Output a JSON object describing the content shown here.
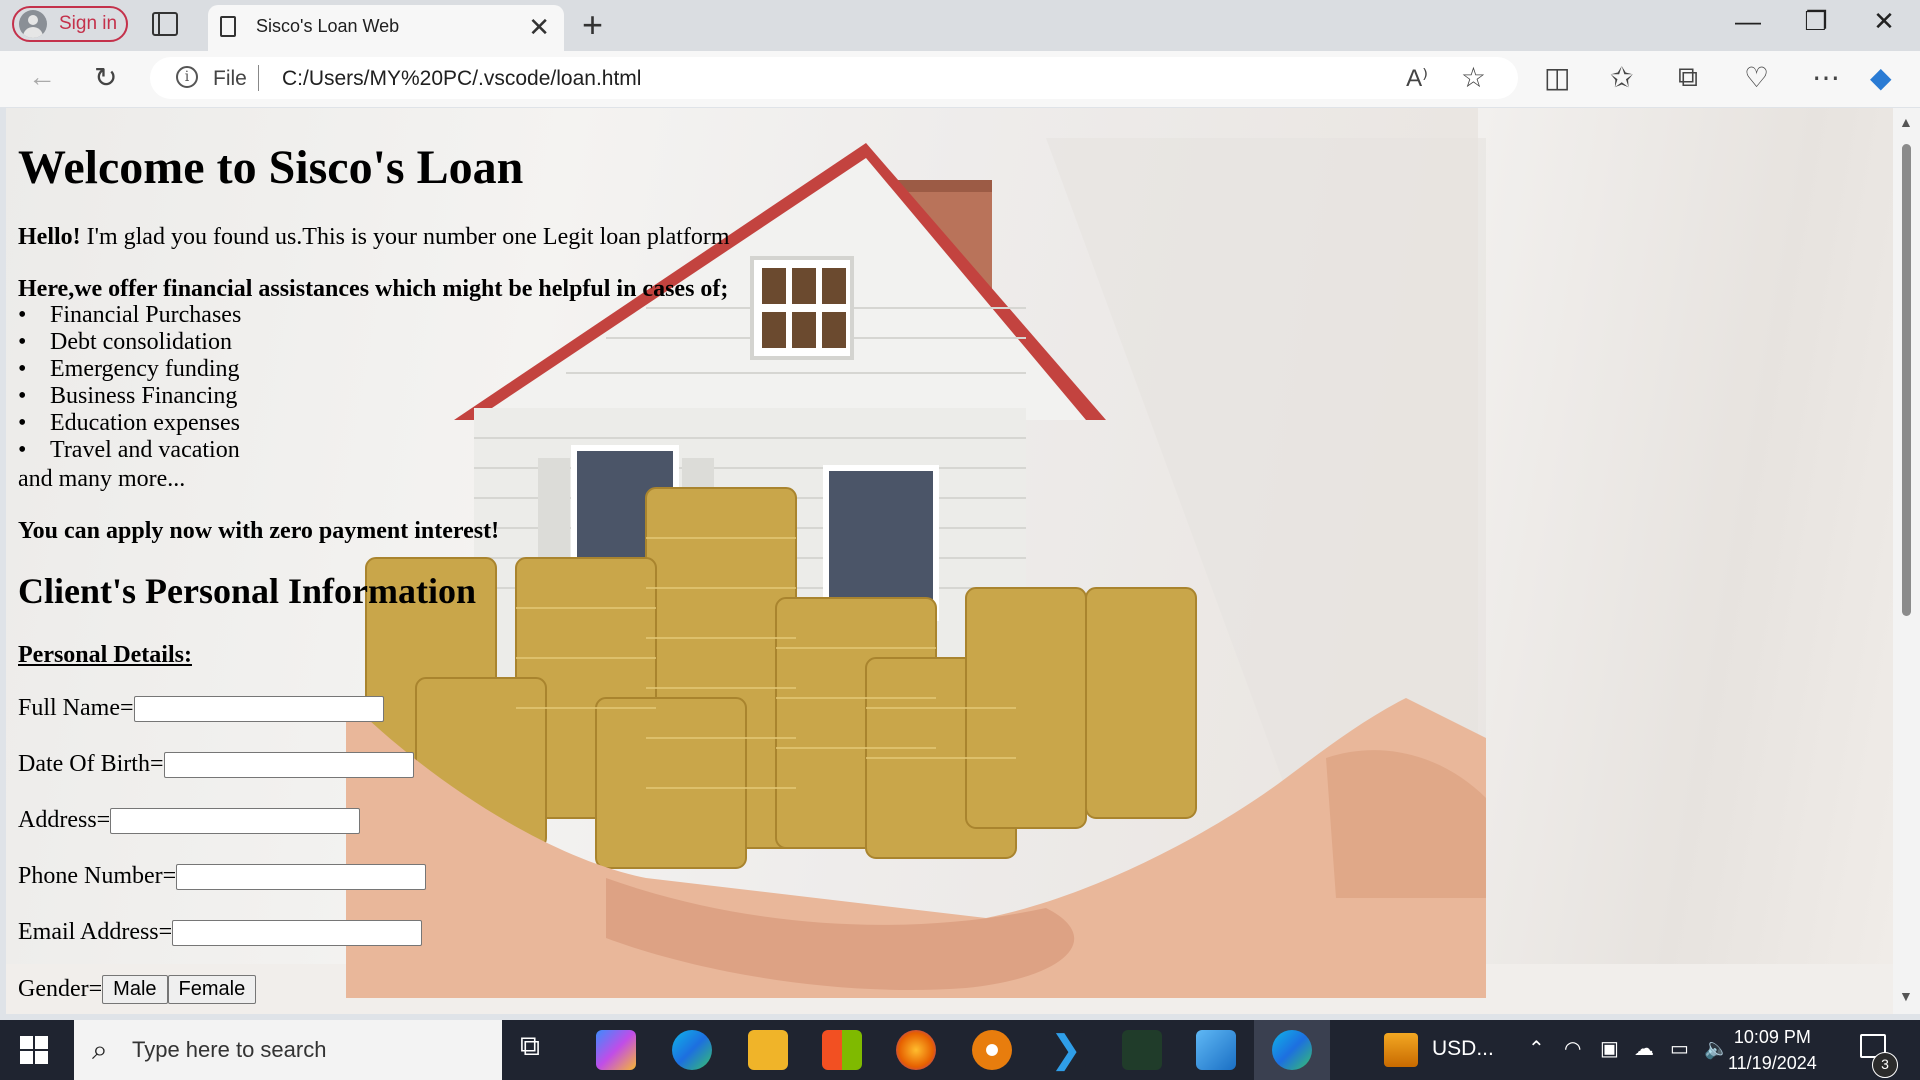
{
  "browser": {
    "signin_label": "Sign in",
    "tab_title": "Sisco's Loan Web",
    "url_scheme": "File",
    "url": "C:/Users/MY%20PC/.vscode/loan.html"
  },
  "page": {
    "heading": "Welcome to Sisco's Loan",
    "hello_bold": "Hello!",
    "hello_text": " I'm glad you found us.This is your number one Legit loan platform",
    "offer": "Here,we offer financial assistances which might be helpful in cases of;",
    "services": [
      "Financial Purchases",
      "Debt consolidation",
      "Emergency funding",
      "Business Financing",
      "Education expenses",
      "Travel and vacation"
    ],
    "more": "and many more...",
    "apply": "You can apply now with zero payment interest!",
    "section_title": "Client's Personal Information",
    "details_label": "Personal Details:",
    "fields": {
      "full_name": "Full Name=",
      "dob": "Date Of Birth=",
      "address": "Address=",
      "phone": "Phone Number=",
      "email": "Email Address=",
      "gender": "Gender="
    },
    "gender_options": [
      "Male",
      "Female"
    ]
  },
  "taskbar": {
    "search_placeholder": "Type here to search",
    "currency_widget": "USD...",
    "time": "10:09 PM",
    "date": "11/19/2024",
    "notification_count": "3"
  },
  "colors": {
    "signin_accent": "#c4314b",
    "taskbar_bg": "#1f2430",
    "tabstrip_bg": "#dadde1"
  }
}
